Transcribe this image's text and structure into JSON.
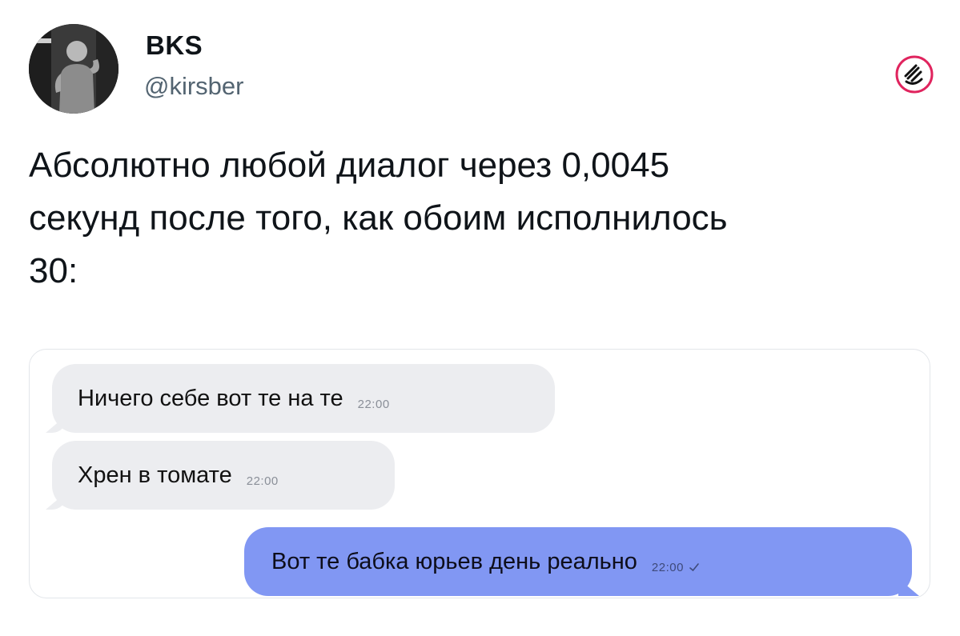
{
  "author": {
    "display_name": "BKS",
    "handle": "@kirsber",
    "avatar_icon": "avatar-photo"
  },
  "brand_icon": "grok-icon",
  "tweet": {
    "lines": [
      "Абсолютно любой диалог через 0,0045",
      "секунд после того, как обоим исполнилось",
      "30:"
    ]
  },
  "chat": {
    "messages": [
      {
        "text": "Ничего себе вот те на те",
        "time": "22:00",
        "direction": "incoming"
      },
      {
        "text": "Хрен в томате",
        "time": "22:00",
        "direction": "incoming"
      },
      {
        "text": "Вот те бабка юрьев день реально",
        "time": "22:00",
        "direction": "outgoing",
        "status_icon": "check-icon"
      }
    ]
  },
  "colors": {
    "outgoing_bubble": "#8197f3",
    "incoming_bubble": "#ecedf0",
    "handle_text": "#536471"
  }
}
